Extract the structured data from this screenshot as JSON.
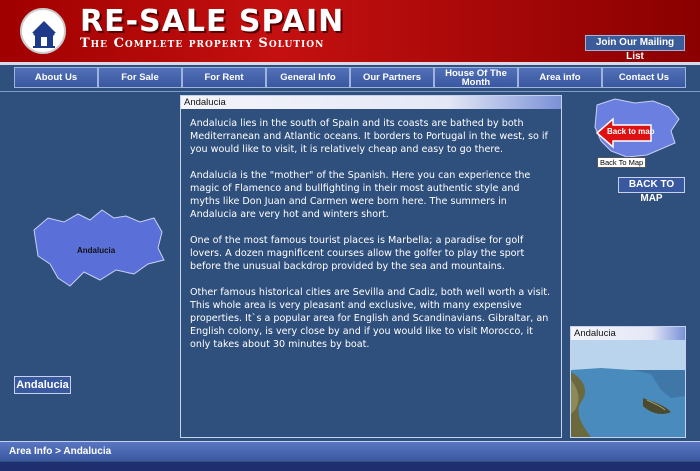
{
  "header": {
    "brand": "RE-SALE SPAIN",
    "tagline": "The Complete property Solution",
    "mailing_button": "Join Our Mailing List",
    "logo_icon": "house-sun-icon"
  },
  "nav": {
    "items": [
      {
        "label": "About Us"
      },
      {
        "label": "For Sale"
      },
      {
        "label": "For Rent"
      },
      {
        "label": "General Info"
      },
      {
        "label": "Our Partners"
      },
      {
        "label": "House Of The Month"
      },
      {
        "label": "Area info"
      },
      {
        "label": "Contact Us"
      }
    ]
  },
  "left": {
    "map_label": "Andalucia",
    "button_label": "Andalucia"
  },
  "content": {
    "title": "Andalucia",
    "paragraphs": [
      "Andalucia lies in the south of Spain and its coasts are bathed by both Mediterranean and Atlantic oceans. It borders to Portugal in the west, so if you would like to visit, it is relatively cheap and easy to go there.",
      "Andalucia is the \"mother\" of the Spanish. Here you can experience the magic of Flamenco and bullfighting in their most authentic style and myths like Don Juan and Carmen were born here. The summers in Andalucia are very hot and winters short.",
      "One of the most famous tourist places is Marbella; a paradise for golf lovers. A dozen magnificent courses allow the golfer to play the sport before the unusual backdrop provided by the sea and mountains.",
      "Other famous historical cities are Sevilla and Cadiz, both well worth a visit. This whole area is very pleasant and exclusive, with many expensive properties. It`s a popular area for English and Scandinavians. Gibraltar, an English colony, is very close by and if you would like to visit Morocco, it only takes about 30 minutes by boat."
    ]
  },
  "right": {
    "back_arrow_label": "Back to map",
    "tooltip": "Back To Map",
    "back_button": "BACK TO MAP",
    "photo_title": "Andalucia"
  },
  "footer": {
    "breadcrumb": "Area Info > Andalucia"
  },
  "colors": {
    "page_bg": "#2f4f7d",
    "header_red": "#c41010",
    "nav_blue": "#3a58a0",
    "map_blue": "#5a6fd6"
  }
}
